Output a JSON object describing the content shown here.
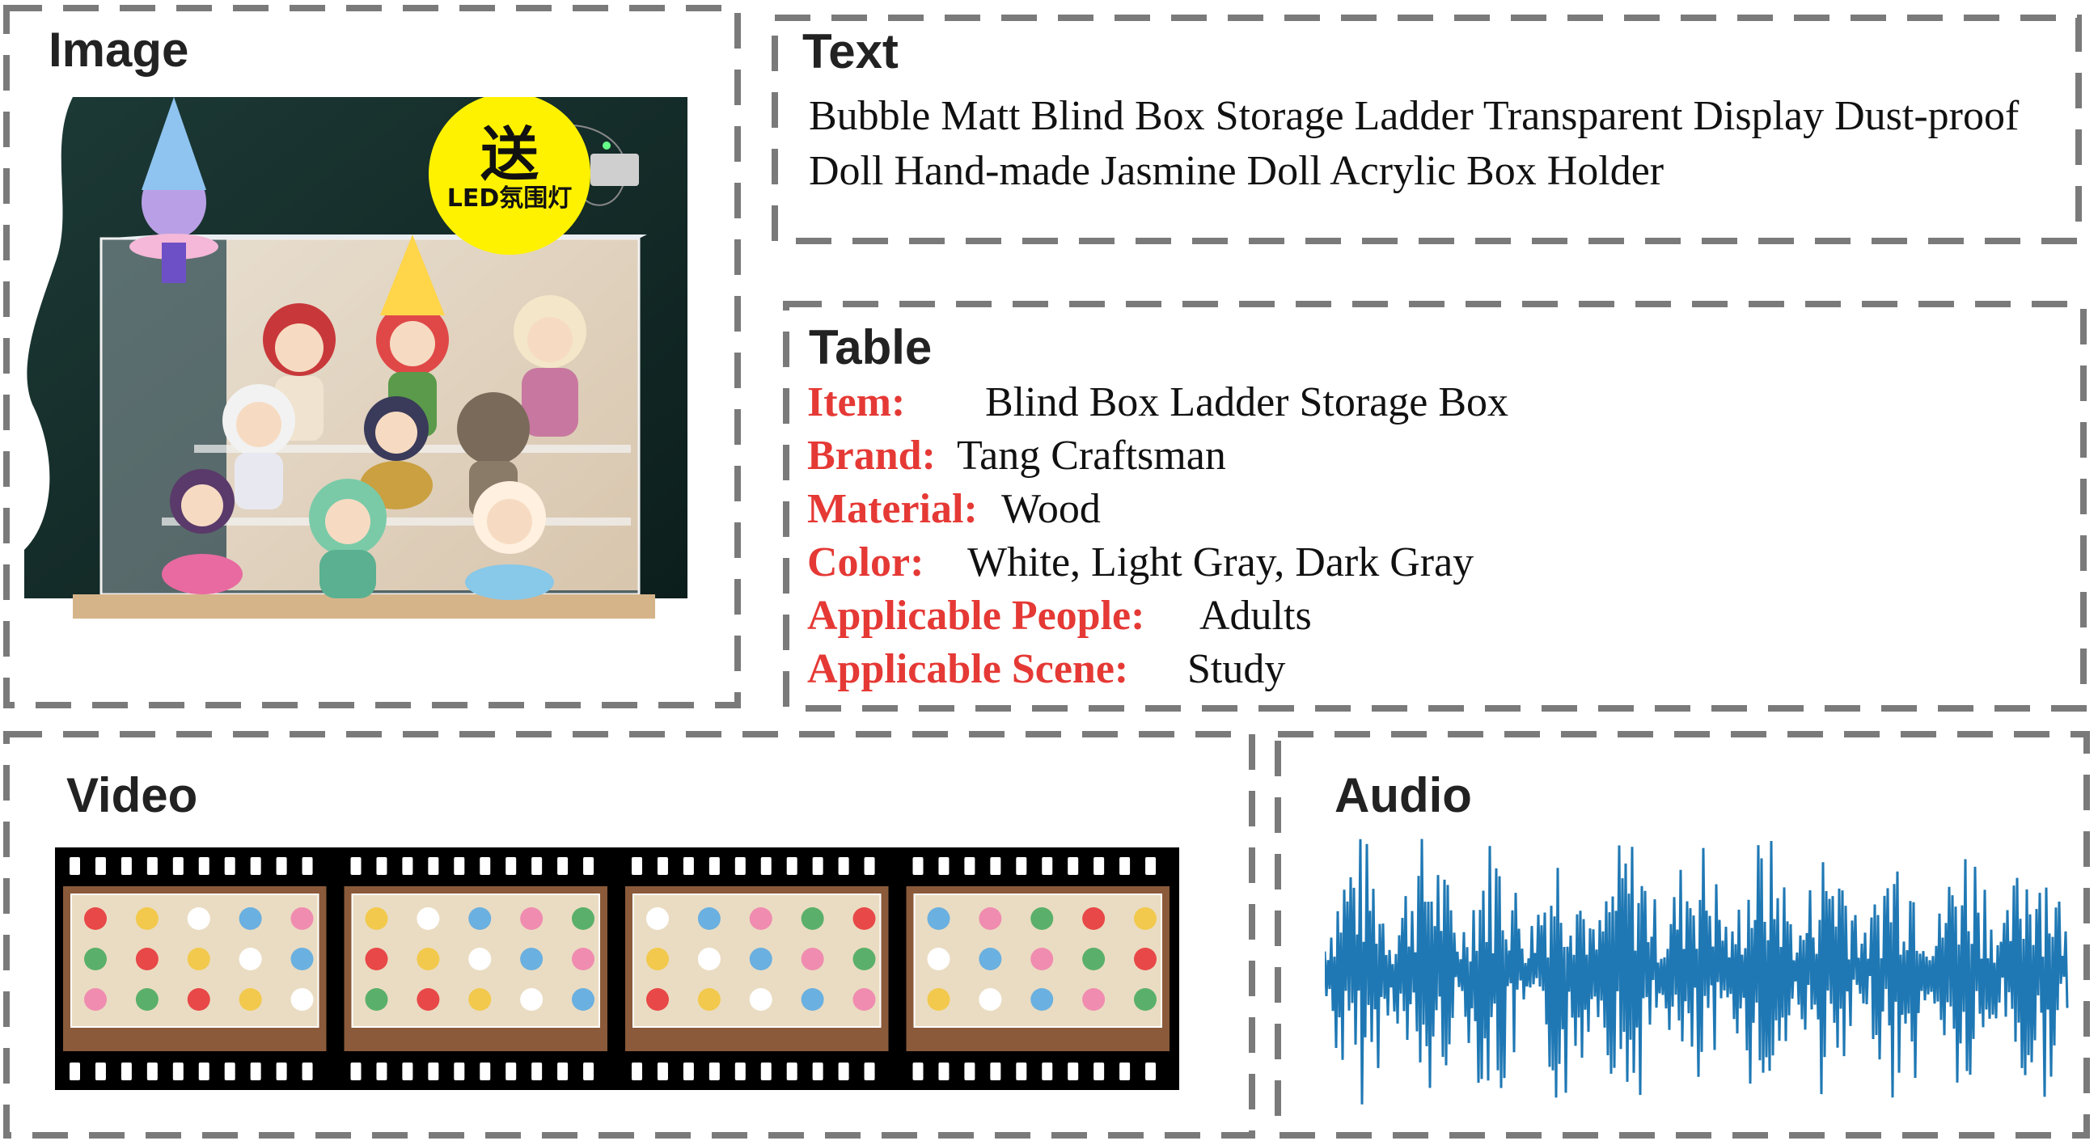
{
  "panels": {
    "image": {
      "title": "Image",
      "badge": {
        "main": "送",
        "sub": "LED氛围灯",
        "color": "#fff200"
      }
    },
    "text": {
      "title": "Text",
      "content": "Bubble Matt Blind Box Storage Ladder Transparent Display Dust-proof Doll Hand-made Jasmine Doll Acrylic Box Holder"
    },
    "table": {
      "title": "Table",
      "key_color": "#e53935",
      "rows": [
        {
          "key": "Item:",
          "value": "Blind Box Ladder Storage Box"
        },
        {
          "key": "Brand:",
          "value": "Tang Craftsman"
        },
        {
          "key": "Material:",
          "value": "Wood"
        },
        {
          "key": "Color:",
          "value": "White, Light Gray, Dark Gray"
        },
        {
          "key": "Applicable People:",
          "value": "Adults"
        },
        {
          "key": "Applicable Scene:",
          "value": "Study"
        }
      ]
    },
    "video": {
      "title": "Video",
      "frame_count": 4
    },
    "audio": {
      "title": "Audio",
      "waveform_color": "#1f78b4"
    }
  },
  "colors": {
    "border": "#7a7a7a",
    "film": "#000000"
  }
}
